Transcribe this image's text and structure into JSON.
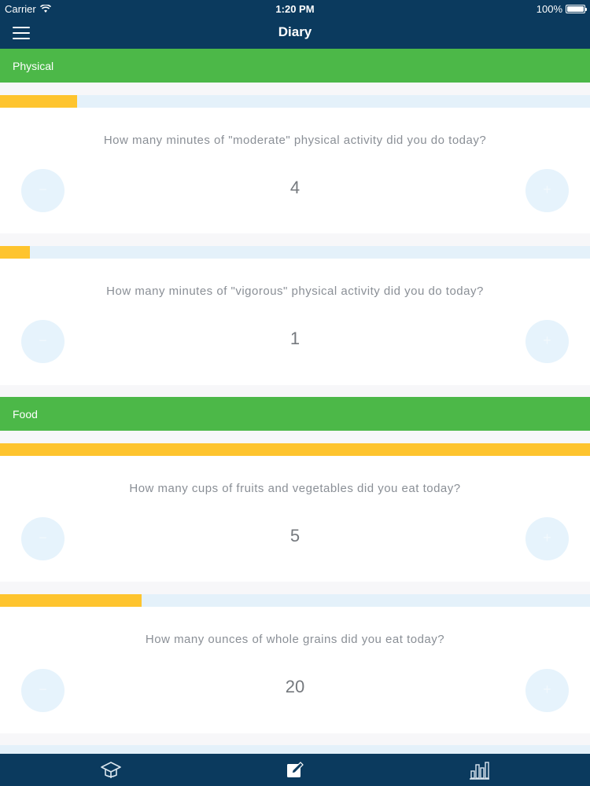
{
  "status_bar": {
    "carrier": "Carrier",
    "time": "1:20 PM",
    "battery": "100%"
  },
  "nav": {
    "title": "Diary",
    "menu_icon": "hamburger-menu-icon"
  },
  "sections": [
    {
      "title": "Physical",
      "questions": [
        {
          "text": "How many minutes of \"moderate\" physical activity did you do today?",
          "value": "4",
          "progress": 0.13
        },
        {
          "text": "How many minutes of \"vigorous\" physical activity did you do today?",
          "value": "1",
          "progress": 0.05
        }
      ]
    },
    {
      "title": "Food",
      "questions": [
        {
          "text": "How many cups of fruits and vegetables did you eat today?",
          "value": "5",
          "progress": 1.0
        },
        {
          "text": "How many ounces of whole grains did you eat today?",
          "value": "20",
          "progress": 0.24
        }
      ]
    }
  ],
  "tabs": [
    {
      "icon": "graduation-cap-icon"
    },
    {
      "icon": "edit-note-icon"
    },
    {
      "icon": "bar-chart-icon"
    }
  ],
  "colors": {
    "navy": "#0b3a5e",
    "section_green": "#4cb848",
    "progress_yellow": "#fec42e",
    "progress_track": "#e4f1fa",
    "stepper_bg": "#e6f3fc"
  }
}
